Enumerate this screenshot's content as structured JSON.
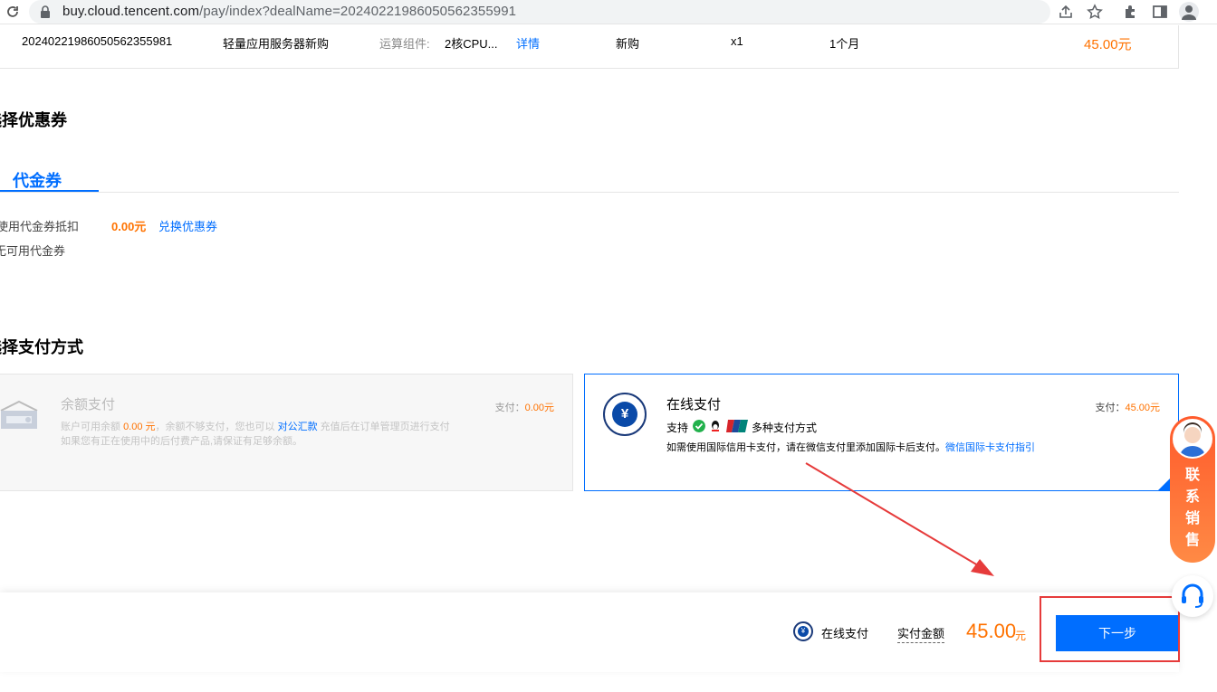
{
  "browser": {
    "url_domain": "buy.cloud.tencent.com",
    "url_path": "/pay/index?dealName=20240221986050562355991"
  },
  "order": {
    "id": "20240221986050562355981",
    "product": "轻量应用服务器新购",
    "spec_label": "运算组件:",
    "spec_value": "2核CPU...",
    "detail_link": "详情",
    "type": "新购",
    "quantity": "x1",
    "duration": "1个月",
    "price": "45.00元"
  },
  "coupon_section": {
    "title": "选择优惠券",
    "tab": "代金券",
    "deduct_label": "使用代金券抵扣",
    "deduct_amount": "0.00元",
    "exchange_link": "兑换优惠券",
    "none_text": "无可用代金券"
  },
  "payment_section": {
    "title": "选择支付方式",
    "balance": {
      "title": "余额支付",
      "pay_label": "支付：",
      "pay_amount": "0.00元",
      "desc1_a": "账户可用余额 ",
      "desc1_amt": "0.00 元",
      "desc1_b": "，余额不够支付，您也可以 ",
      "desc1_link": "对公汇款",
      "desc1_c": " 充值后在订单管理页进行支付",
      "desc2": "如果您有正在使用中的后付费产品,请保证有足够余额。"
    },
    "online": {
      "title": "在线支付",
      "pay_label": "支付：",
      "pay_amount": "45.00元",
      "support_label": "支持",
      "methods_text": "多种支付方式",
      "note": "如需使用国际信用卡支付，请在微信支付里添加国际卡后支付。",
      "note_link": "微信国际卡支付指引",
      "icon_glyph": "¥"
    }
  },
  "footer": {
    "method": "在线支付",
    "amount_label": "实付金额",
    "amount": "45.00",
    "unit": "元",
    "next_button": "下一步"
  },
  "side_widgets": {
    "sales_text": [
      "联",
      "系",
      "销",
      "售"
    ]
  },
  "colors": {
    "accent": "#006eff",
    "price": "#ff7200",
    "annotation": "#e63b3b"
  }
}
